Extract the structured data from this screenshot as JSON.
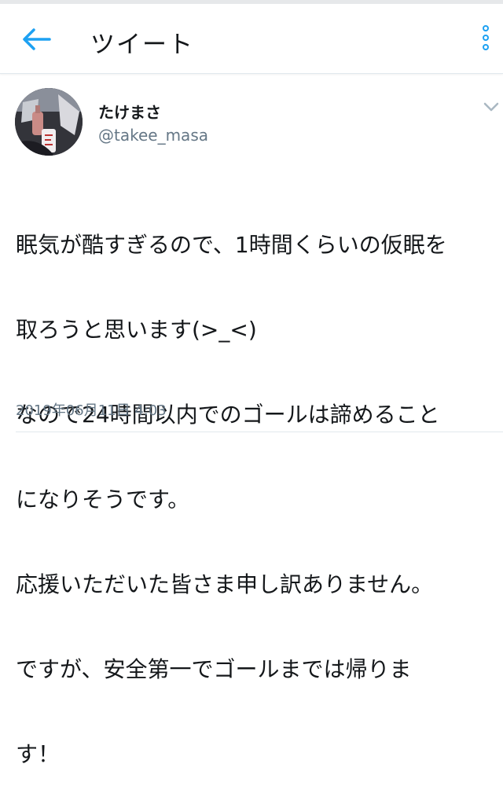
{
  "header": {
    "back_icon": "arrow-left-icon",
    "title": "ツイート",
    "menu_icon": "kebab-vertical-icon",
    "accent_color": "#1da1f2"
  },
  "tweet": {
    "display_name": "たけまさ",
    "handle": "@takee_masa",
    "caret_icon": "chevron-down-icon",
    "body_lines": [
      "眠気が酷すぎるので、1時間くらいの仮眠を",
      "取ろうと思います(>_<)",
      "なので24時間以内でのゴールは諦めること",
      "になりそうです。",
      "応援いただいた皆さま申し訳ありません。",
      "ですが、安全第一でゴールまでは帰りま",
      "す！"
    ],
    "timestamp": "2019年06月11日 4:03"
  }
}
